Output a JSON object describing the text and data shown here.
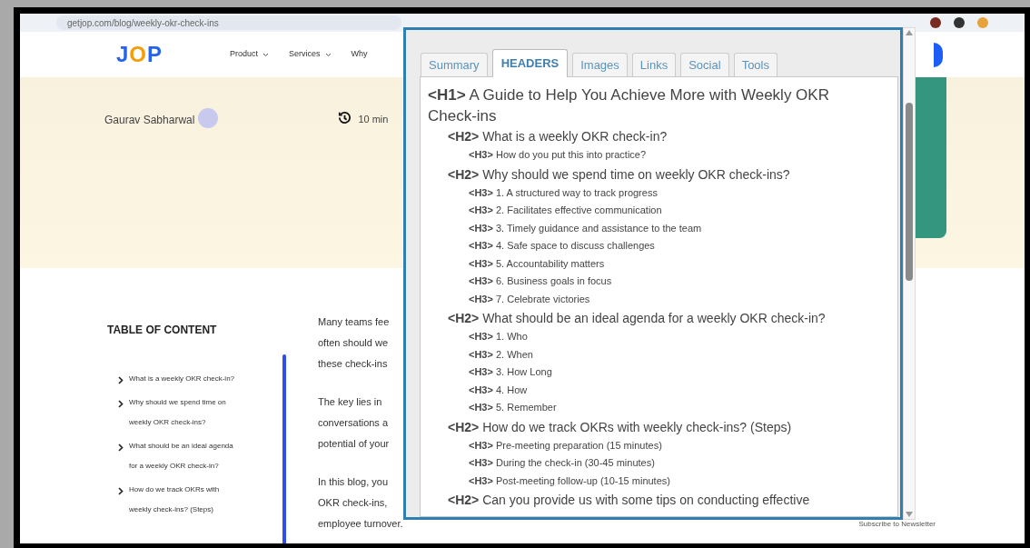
{
  "browser": {
    "url": "getjop.com/blog/weekly-okr-check-ins"
  },
  "site": {
    "logo": "JOP",
    "nav": [
      "Product",
      "Services",
      "Why"
    ]
  },
  "author": {
    "name": "Gaurav Sabharwal"
  },
  "read_time": "10 min",
  "toc": {
    "title": "TABLE OF CONTENT",
    "items": [
      {
        "lines": [
          "What is a weekly OKR check-in?"
        ]
      },
      {
        "lines": [
          "Why should we spend time on",
          "weekly OKR check-ins?"
        ]
      },
      {
        "lines": [
          "What should be an ideal agenda",
          "for a weekly OKR check-in?"
        ]
      },
      {
        "lines": [
          "How do we track OKRs with",
          "weekly check-ins? (Steps)"
        ]
      }
    ]
  },
  "article": {
    "paragraphs": [
      [
        "Many teams fee",
        "often should we",
        "these check-ins"
      ],
      [
        "The key lies in",
        "conversations a",
        "potential of your"
      ],
      [
        "In this blog, you",
        "OKR check-ins,",
        "employee turnover."
      ]
    ]
  },
  "extension": {
    "tabs": [
      {
        "label": "Summary",
        "selected": false
      },
      {
        "label": "HEADERS",
        "selected": true
      },
      {
        "label": "Images",
        "selected": false
      },
      {
        "label": "Links",
        "selected": false
      },
      {
        "label": "Social",
        "selected": false
      },
      {
        "label": "Tools",
        "selected": false
      }
    ],
    "headers": [
      {
        "tag": "<H1>",
        "text": "A Guide to Help You Achieve More with Weekly OKR Check-ins",
        "children": [
          {
            "tag": "<H2>",
            "text": "What is a weekly OKR check-in?",
            "children": [
              {
                "tag": "<H3>",
                "text": "How do you put this into practice?"
              }
            ]
          },
          {
            "tag": "<H2>",
            "text": "Why should we spend time on weekly OKR check-ins?",
            "children": [
              {
                "tag": "<H3>",
                "text": "1. A structured way to track progress"
              },
              {
                "tag": "<H3>",
                "text": "2. Facilitates effective communication"
              },
              {
                "tag": "<H3>",
                "text": "3. Timely guidance and assistance to the team"
              },
              {
                "tag": "<H3>",
                "text": "4. Safe space to discuss challenges"
              },
              {
                "tag": "<H3>",
                "text": "5. Accountability matters"
              },
              {
                "tag": "<H3>",
                "text": "6. Business goals in focus"
              },
              {
                "tag": "<H3>",
                "text": "7. Celebrate victories"
              }
            ]
          },
          {
            "tag": "<H2>",
            "text": "What should be an ideal agenda for a weekly OKR check-in?",
            "children": [
              {
                "tag": "<H3>",
                "text": "1. Who"
              },
              {
                "tag": "<H3>",
                "text": "2. When"
              },
              {
                "tag": "<H3>",
                "text": "3. How Long"
              },
              {
                "tag": "<H3>",
                "text": "4. How"
              },
              {
                "tag": "<H3>",
                "text": "5. Remember"
              }
            ]
          },
          {
            "tag": "<H2>",
            "text": "How do we track OKRs with weekly check-ins? (Steps)",
            "children": [
              {
                "tag": "<H3>",
                "text": "Pre-meeting preparation (15 minutes)"
              },
              {
                "tag": "<H3>",
                "text": "During the check-in (30-45 minutes)"
              },
              {
                "tag": "<H3>",
                "text": "Post-meeting follow-up (10-15 minutes)"
              }
            ]
          },
          {
            "tag": "<H2>",
            "text": "Can you provide us with some tips on conducting effective"
          }
        ]
      }
    ]
  },
  "footer": {
    "subscribe": "Subscribe to Newsletter"
  }
}
